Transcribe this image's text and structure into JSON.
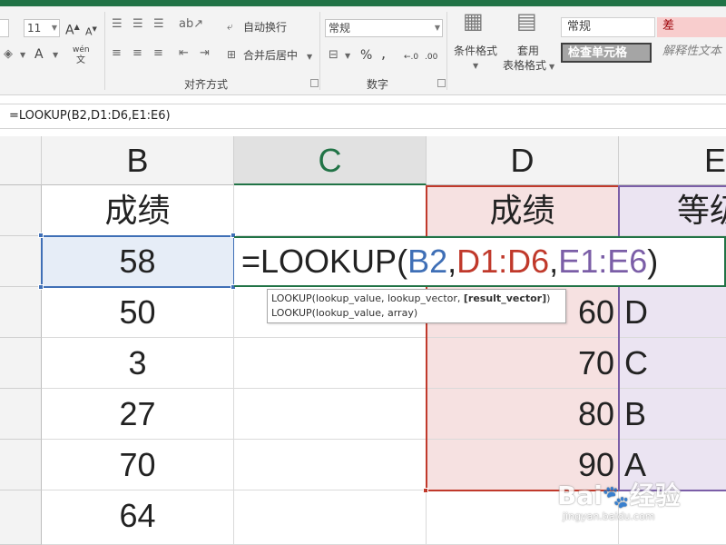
{
  "ribbon": {
    "font_size": "11",
    "grow_font": "A",
    "shrink_font": "A",
    "font_color": "A",
    "phonetic": "wén",
    "wrap_text": "自动换行",
    "merge_center": "合并后居中",
    "alignment_label": "对齐方式",
    "number_format": "常规",
    "number_label": "数字",
    "percent": "%",
    "comma": ",",
    "decimal_inc": "←.0",
    "decimal_dec": ".00",
    "conditional_format": "条件格式",
    "table_format_line1": "套用",
    "table_format_line2": "表格格式",
    "styles": {
      "normal": "常规",
      "bad": "差",
      "check_cell": "检查单元格",
      "explanatory": "解释性文本"
    }
  },
  "formula_bar": {
    "text": "=LOOKUP(B2,D1:D6,E1:E6)"
  },
  "columns": [
    "B",
    "C",
    "D",
    "E"
  ],
  "cells": {
    "B1": "成绩",
    "B2": "58",
    "B3": "50",
    "B4": "3",
    "B5": "27",
    "B6": "70",
    "B7": "64",
    "D1": "成绩",
    "D3": "60",
    "D4": "70",
    "D5": "80",
    "D6": "90",
    "E1": "等级",
    "E3": "D",
    "E4": "C",
    "E5": "B",
    "E6": "A"
  },
  "editing": {
    "prefix": "=LOOKUP(",
    "arg1": "B2",
    "comma1": ",",
    "arg2": "D1:D6",
    "comma2": ",",
    "arg3": "E1:E6",
    "suffix": ")"
  },
  "tooltip": {
    "line1_text": "LOOKUP(lookup_value, lookup_vector, ",
    "line1_bold": "[result_vector]",
    "line1_end": ")",
    "line2": "LOOKUP(lookup_value, array)"
  },
  "watermark": {
    "logo_text": "Bai",
    "logo_suffix": "经验",
    "url": "jingyan.baidu.com"
  },
  "colors": {
    "accent": "#217346",
    "ref_blue": "#3f6fb6",
    "ref_red": "#c0392b",
    "ref_purple": "#7b5ea7",
    "pink_fill": "#f6e1e1",
    "lavender_fill": "#ebe4f2"
  }
}
